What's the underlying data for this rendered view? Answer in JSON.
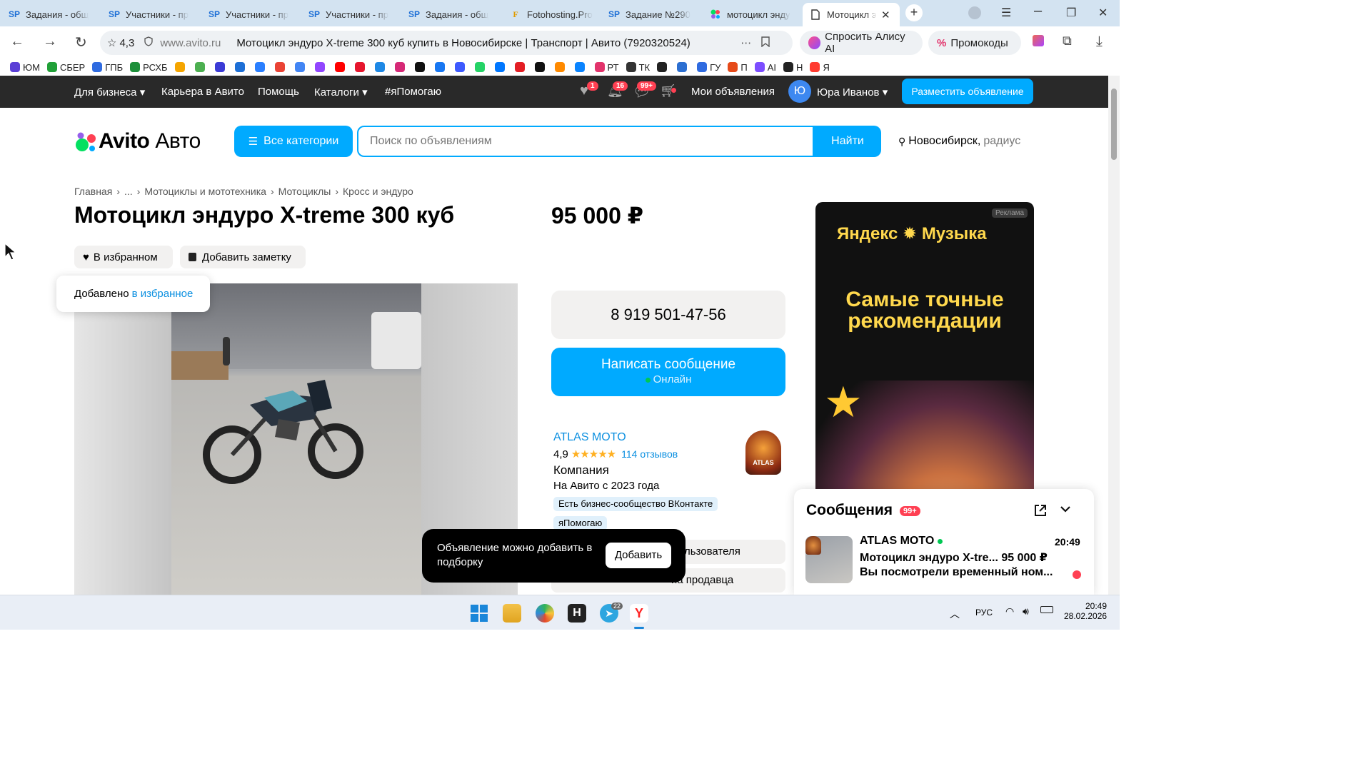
{
  "browser": {
    "tabs": [
      {
        "icon": "SP",
        "label": "Задания - общ"
      },
      {
        "icon": "SP",
        "label": "Участники - пр"
      },
      {
        "icon": "SP",
        "label": "Участники - пр"
      },
      {
        "icon": "SP",
        "label": "Участники - пр"
      },
      {
        "icon": "SP",
        "label": "Задания - общ"
      },
      {
        "icon": "F",
        "label": "Fotohosting.Pro"
      },
      {
        "icon": "SP",
        "label": "Задание №290"
      },
      {
        "icon": "avito",
        "label": "мотоцикл энду"
      },
      {
        "icon": "doc",
        "label": "Мотоцикл эн"
      }
    ],
    "rating": "4,3",
    "domain": "www.avito.ru",
    "page_title": "Мотоцикл эндуро X-treme 300 куб купить в Новосибирске | Транспорт | Авито (7920320524)",
    "alice_label": "Спросить Алису AI",
    "promo_label": "Промокоды",
    "bookmarks": [
      "ЮМ",
      "СБЕР",
      "ГПБ",
      "РСХБ",
      "",
      "",
      "",
      "",
      "",
      "",
      "",
      "",
      "",
      "",
      "",
      "",
      "",
      "",
      "",
      "",
      "",
      "",
      "",
      "",
      "",
      "РТ",
      "ТК",
      "",
      "",
      "ГУ",
      "П",
      "AI",
      "Н",
      "Я"
    ]
  },
  "avito_header": {
    "business": "Для бизнеса",
    "career": "Карьера в Авито",
    "help": "Помощь",
    "catalogs": "Каталоги",
    "ya_help": "#яПомогаю",
    "fav_count": "1",
    "notif_count": "16",
    "msg_count": "99+",
    "my_ads": "Мои объявления",
    "user_initial": "Ю",
    "user_name": "Юра Иванов",
    "post_ad": "Разместить объявление"
  },
  "search": {
    "logo": "Avito",
    "logo_suffix": "Авто",
    "all_categories": "Все категории",
    "placeholder": "Поиск по объявлениям",
    "find": "Найти",
    "city": "Новосибирск,",
    "radius": "радиус"
  },
  "breadcrumbs": [
    "Главная",
    "...",
    "Мотоциклы и мототехника",
    "Мотоциклы",
    "Кросс и эндуро"
  ],
  "listing": {
    "title": "Мотоцикл эндуро X-treme 300 куб",
    "price": "95 000 ₽",
    "favorite_label": "В избранном",
    "note_label": "Добавить заметку",
    "toast_prefix": "Добавлено",
    "toast_link": "в избранное"
  },
  "contact": {
    "phone": "8 919 501-47-56",
    "write_message": "Написать сообщение",
    "online": "Онлайн"
  },
  "seller": {
    "name": "ATLAS MOTO",
    "rating": "4,9",
    "stars": 5,
    "reviews": "114 отзывов",
    "type": "Компания",
    "since": "На Авито с 2023 года",
    "tag1": "Есть бизнес-сообщество ВКонтакте",
    "tag2": "яПомогаю",
    "btn1_tail": "льзователя",
    "btn2_tail": "на продавца",
    "logo_text": "ATLAS"
  },
  "ad_banner": {
    "label": "Реклама",
    "brand": "Яндекс ✹ Музыка",
    "slogan": "Самые точные рекомендации"
  },
  "collection_popup": {
    "text": "Объявление можно добавить в подборку",
    "button": "Добавить"
  },
  "messages": {
    "title": "Сообщения",
    "count": "99+",
    "sender": "ATLAS MOTO",
    "time": "20:49",
    "subject": "Мотоцикл эндуро X-tre... 95 000 ₽",
    "preview": "Вы посмотрели временный ном..."
  },
  "taskbar": {
    "lang": "РУС",
    "time": "20:49",
    "date": "28.02.2026",
    "telegram_badge": "22"
  },
  "colors": {
    "accent_blue": "#00aaff",
    "link_blue": "#0a8fe0",
    "header_dark": "#292929",
    "badge_red": "#ff4053",
    "star": "#ffb021",
    "online_green": "#00c853"
  }
}
